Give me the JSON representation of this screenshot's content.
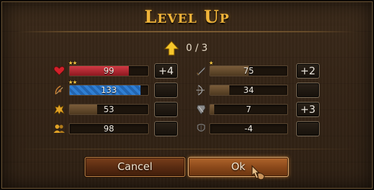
{
  "dialog": {
    "title": "Level Up",
    "points_text": "0 / 3"
  },
  "colors": {
    "title": "#f0b43a",
    "health": "#b6232e",
    "mana": "#2b73c7",
    "neutral": "#6b5135"
  },
  "left_stats": [
    {
      "icon": "heart-icon",
      "value": "99",
      "stars": "★★",
      "plus": "+4",
      "fill": 0.75,
      "color": "#b6232e"
    },
    {
      "icon": "bow-hand-icon",
      "value": "133",
      "stars": "★★",
      "plus": "",
      "fill": 0.9,
      "color": "#2b73c7"
    },
    {
      "icon": "lion-icon",
      "value": "53",
      "stars": "",
      "plus": "",
      "fill": 0.35,
      "color": "#6b5135"
    },
    {
      "icon": "people-icon",
      "value": "98",
      "stars": "",
      "plus": "",
      "fill": 0.0,
      "color": "#6b5135"
    }
  ],
  "right_stats": [
    {
      "icon": "sword-icon",
      "value": "75",
      "stars": "★",
      "plus": "+2",
      "fill": 0.5,
      "color": "#6b5135"
    },
    {
      "icon": "bow-icon",
      "value": "34",
      "stars": "",
      "plus": "",
      "fill": 0.25,
      "color": "#6b5135"
    },
    {
      "icon": "armor-icon",
      "value": "7",
      "stars": "",
      "plus": "+3",
      "fill": 0.05,
      "color": "#6b5135"
    },
    {
      "icon": "shield-icon",
      "value": "-4",
      "stars": "",
      "plus": "",
      "fill": 0.0,
      "color": "#6b5135"
    }
  ],
  "buttons": {
    "cancel": "Cancel",
    "ok": "Ok"
  }
}
